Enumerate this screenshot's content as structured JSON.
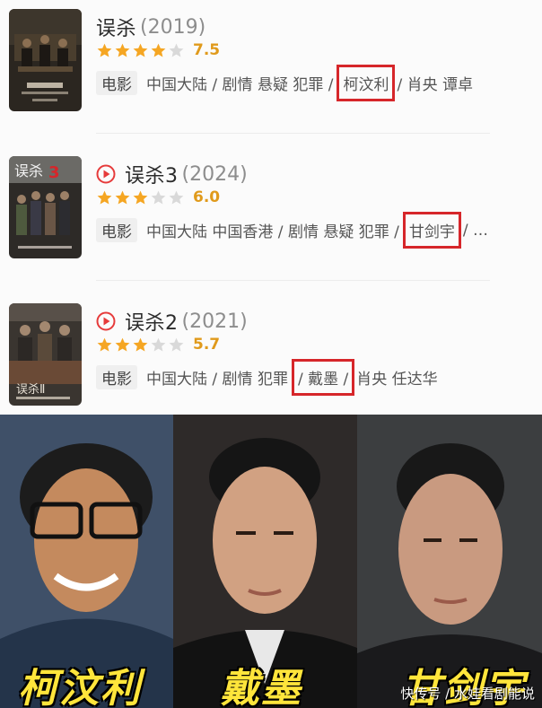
{
  "movies": [
    {
      "title": "误杀",
      "year": "(2019)",
      "has_play_icon": false,
      "stars": 4,
      "score": "7.5",
      "badge": "电影",
      "meta_before": "中国大陆 / 剧情 悬疑 犯罪 /",
      "highlight": "柯汶利",
      "meta_after": "/ 肖央 谭卓"
    },
    {
      "title": "误杀3",
      "year": "(2024)",
      "has_play_icon": true,
      "stars": 3,
      "score": "6.0",
      "badge": "电影",
      "meta_before": "中国大陆 中国香港 / 剧情 悬疑 犯罪 /",
      "highlight": "甘剑宇",
      "meta_after": "/ …"
    },
    {
      "title": "误杀2",
      "year": "(2021)",
      "has_play_icon": true,
      "stars": 3,
      "score": "5.7",
      "badge": "电影",
      "meta_before": "中国大陆 / 剧情 犯罪",
      "highlight": "/ 戴墨 /",
      "meta_after": "肖央 任达华"
    }
  ],
  "portraits": [
    {
      "caption": "柯汶利"
    },
    {
      "caption": "戴墨"
    },
    {
      "caption": "甘剑宇"
    }
  ],
  "watermark": "快传号 / 水娃看剧能说",
  "colors": {
    "star_fill": "#f5a623",
    "star_empty": "#d9d9d9",
    "highlight_box": "#d6262a",
    "play_icon": "#e63b3b",
    "caption": "#ffe53b"
  }
}
